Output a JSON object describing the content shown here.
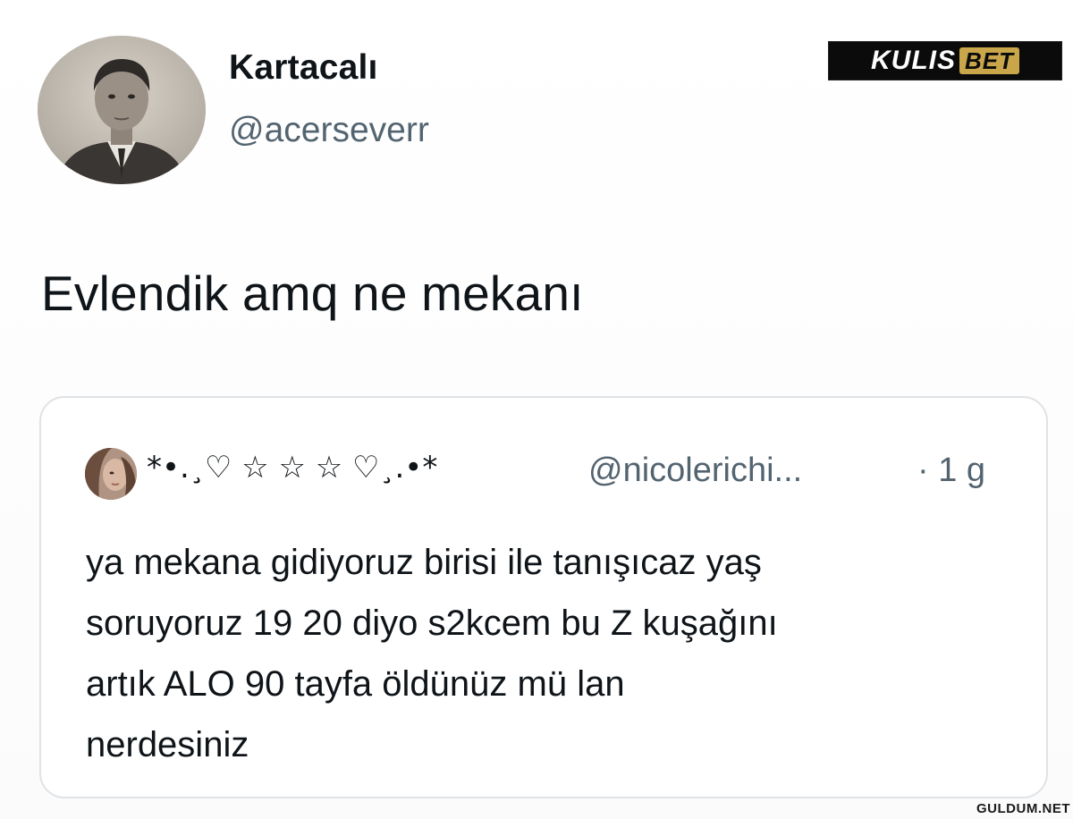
{
  "author": {
    "display_name": "Kartacalı",
    "handle": "@acerseverr",
    "avatar_icon": "vintage-portrait-photo"
  },
  "watermark": {
    "brand_part1": "KULIS",
    "brand_part2": "BET",
    "brand_accent": "#c9a64a",
    "site": "GULDUM.NET"
  },
  "tweet": {
    "text": "Evlendik amq ne mekanı"
  },
  "quoted": {
    "display_name": "*•.¸♡ ☆ ☆ ☆ ♡¸.•*",
    "handle": "@nicolerichi...",
    "time": "· 1 g",
    "avatar_icon": "profile-photo",
    "text_lines": [
      "ya mekana gidiyoruz birisi ile tanışıcaz yaş",
      "soruyoruz 19 20 diyo s2kcem bu Z kuşağını",
      "artık ALO 90 tayfa öldünüz mü lan",
      "nerdesiniz"
    ]
  },
  "colors": {
    "primary_text": "#0f1419",
    "secondary_text": "#536471",
    "card_border": "#dfe3e6"
  }
}
